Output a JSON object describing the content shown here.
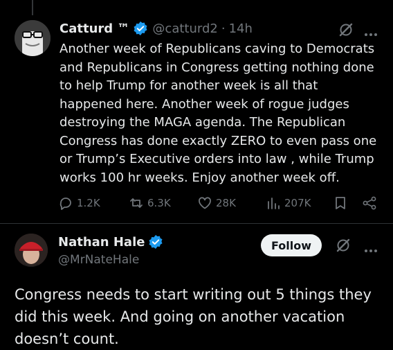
{
  "tweet": {
    "author_name": "Catturd ™",
    "handle": "@catturd2",
    "separator": "·",
    "time": "14h",
    "text": "Another week of Republicans caving to Democrats and Republicans in Congress getting nothing done to help Trump for another week is all that happened here. Another week of rogue judges destroying the MAGA agenda. The Republican Congress has done exactly ZERO to even pass one or Trump’s Executive orders into law , while Trump works 100 hr weeks. Enjoy another week off.",
    "replies": "1.2K",
    "reposts": "6.3K",
    "likes": "28K",
    "views": "207K"
  },
  "reply": {
    "author_name": "Nathan Hale",
    "handle": "@MrNateHale",
    "follow_label": "Follow",
    "text": "Congress needs to start writing out 5 things they did this week. And going on another vacation doesn’t count."
  },
  "colors": {
    "background": "#000000",
    "text": "#e7e9ea",
    "muted": "#71767b",
    "verified": "#1d9bf0",
    "follow_bg": "#eff3f4"
  },
  "icons": [
    "verified-badge-icon",
    "grok-icon",
    "more-icon",
    "reply-icon",
    "repost-icon",
    "like-icon",
    "views-icon",
    "bookmark-icon",
    "share-icon"
  ]
}
